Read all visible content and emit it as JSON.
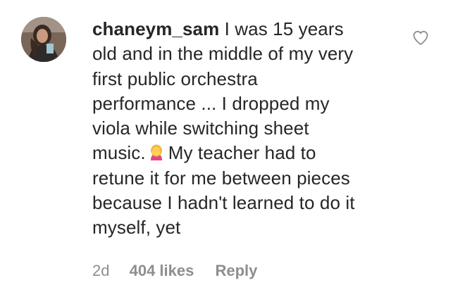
{
  "comment": {
    "username": "chaneym_sam",
    "lines": [
      "I was 15 years",
      "old and in the middle of my very",
      "first public orchestra",
      "performance ... I dropped my",
      "viola while switching sheet",
      "music.",
      "My teacher had to",
      "retune it for me between pieces",
      "because I hadn't learned to do it",
      "myself, yet"
    ],
    "emoji_icon": "woman-facepalming-emoji",
    "time": "2d",
    "likes": "404 likes",
    "reply_label": "Reply",
    "like_icon": "heart-outline-icon"
  },
  "colors": {
    "text": "#262626",
    "secondary": "#8e8e8e"
  }
}
